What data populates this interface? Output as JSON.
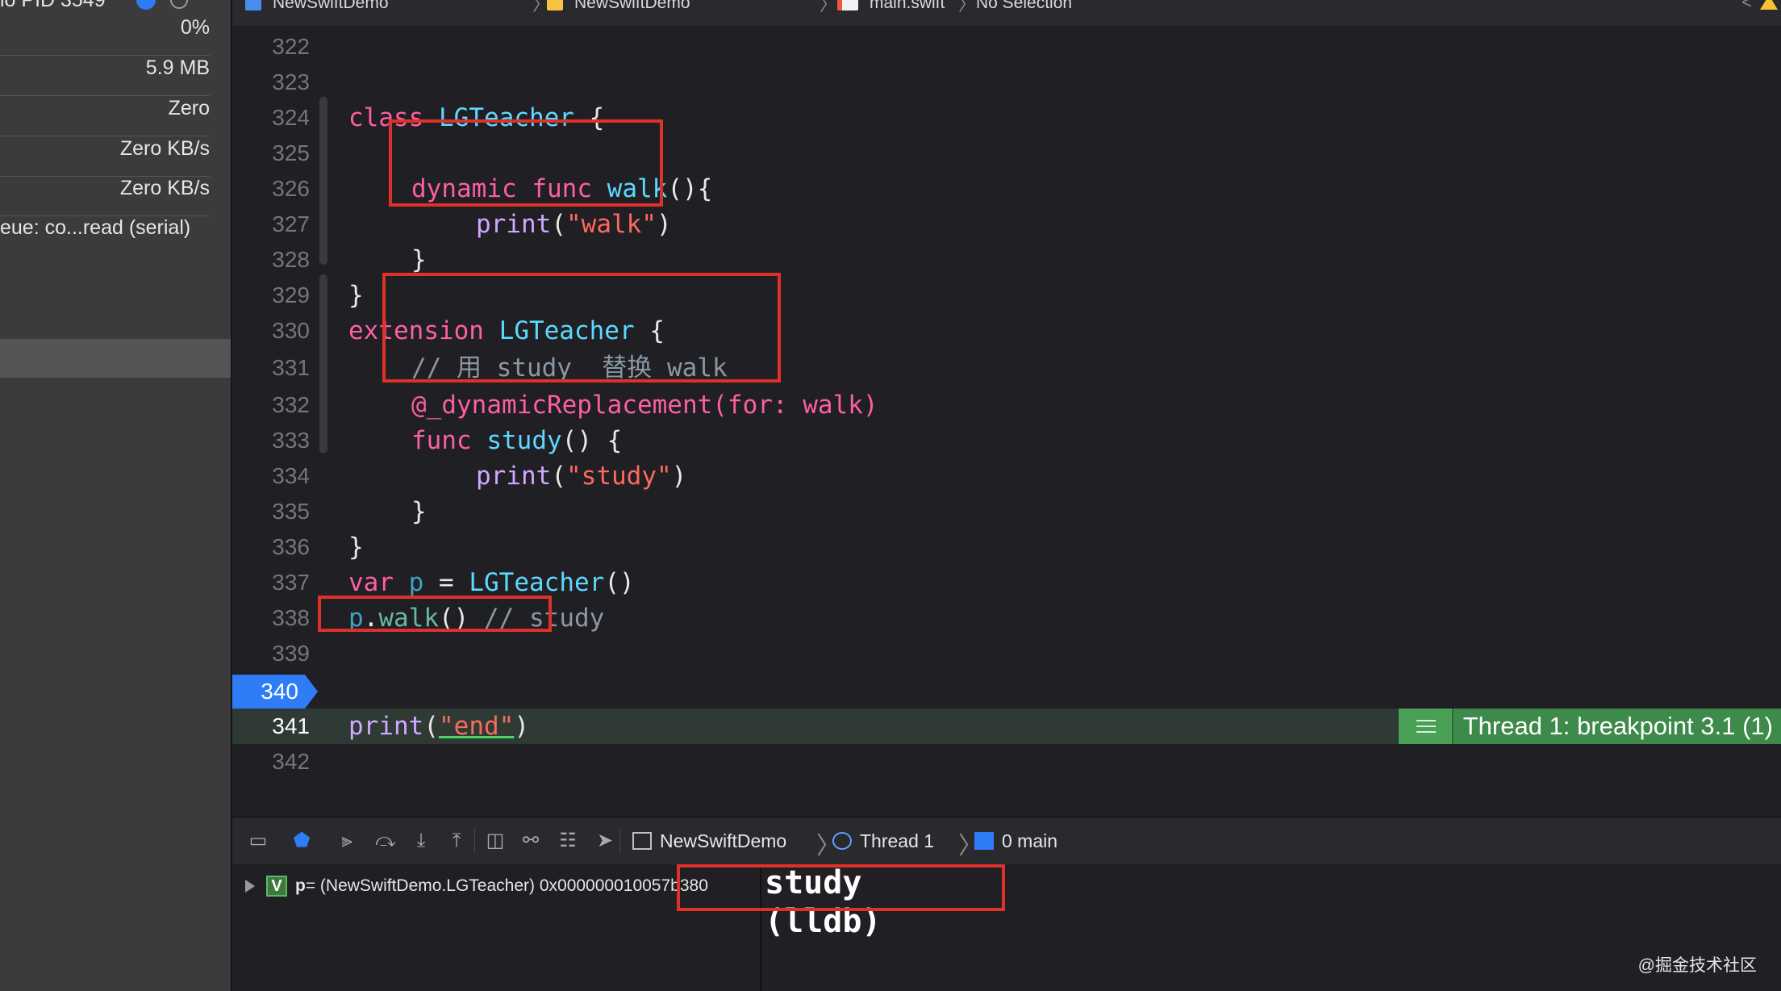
{
  "navigator": {
    "top_label": "io PID 3549",
    "rows": [
      "0%",
      "5.9 MB",
      "Zero",
      "Zero KB/s",
      "Zero KB/s"
    ],
    "queue": "eue: co...read (serial)"
  },
  "jumpbar": {
    "items": [
      "NewSwiftDemo",
      "NewSwiftDemo",
      "main.swift",
      "No Selection"
    ],
    "separator": "〉"
  },
  "editor": {
    "line_numbers": [
      "322",
      "323",
      "324",
      "325",
      "326",
      "327",
      "328",
      "329",
      "330",
      "331",
      "332",
      "333",
      "334",
      "335",
      "336",
      "337",
      "338",
      "339",
      "340",
      "341",
      "342"
    ],
    "lines": {
      "l324": {
        "k": "class",
        "t": "LGTeacher",
        "r": " {"
      },
      "l326": {
        "k": "dynamic",
        "k2": "func",
        "f": "walk",
        "r": "(){"
      },
      "l327": {
        "p": "print",
        "o": "(",
        "s": "\"walk\"",
        "c": ")"
      },
      "l328": "}",
      "l329": "}",
      "l330": {
        "k": "extension",
        "t": "LGTeacher",
        "r": " {"
      },
      "l331": "// 用 study  替换 walk",
      "l332": {
        "a": "@_dynamicReplacement(for: walk)"
      },
      "l333": {
        "k": "func",
        "f": "study",
        "r": "() {"
      },
      "l334": {
        "p": "print",
        "o": "(",
        "s": "\"study\"",
        "c": ")"
      },
      "l335": "}",
      "l336": "}",
      "l337": {
        "k": "var",
        "v": "p",
        "eq": " = ",
        "t": "LGTeacher",
        "r": "()"
      },
      "l338": {
        "v": "p",
        "dot": ".",
        "f": "walk",
        "r": "() ",
        "cm": "// study"
      },
      "l341": {
        "p": "print",
        "o": "(",
        "s": "\"end\"",
        "c": ")"
      }
    },
    "breakpoint_line": "340",
    "current_line": "341",
    "thread_badge": "Thread 1: breakpoint 3.1 (1)"
  },
  "debugbar": {
    "crumbs": [
      "NewSwiftDemo",
      "Thread 1",
      "0 main"
    ]
  },
  "variables": {
    "badge": "V",
    "name": "p",
    "value": " = (NewSwiftDemo.LGTeacher) 0x000000010057b380"
  },
  "console": {
    "lines": [
      "study",
      "(lldb)"
    ]
  },
  "watermark": "@掘金技术社区",
  "colors": {
    "keyword": "#fc5fa3",
    "type": "#5dd8ff",
    "string": "#fc6a5d",
    "highlight_box": "#e0302a",
    "breakpoint": "#2f7df6",
    "thread_badge": "#3d8a4a"
  }
}
